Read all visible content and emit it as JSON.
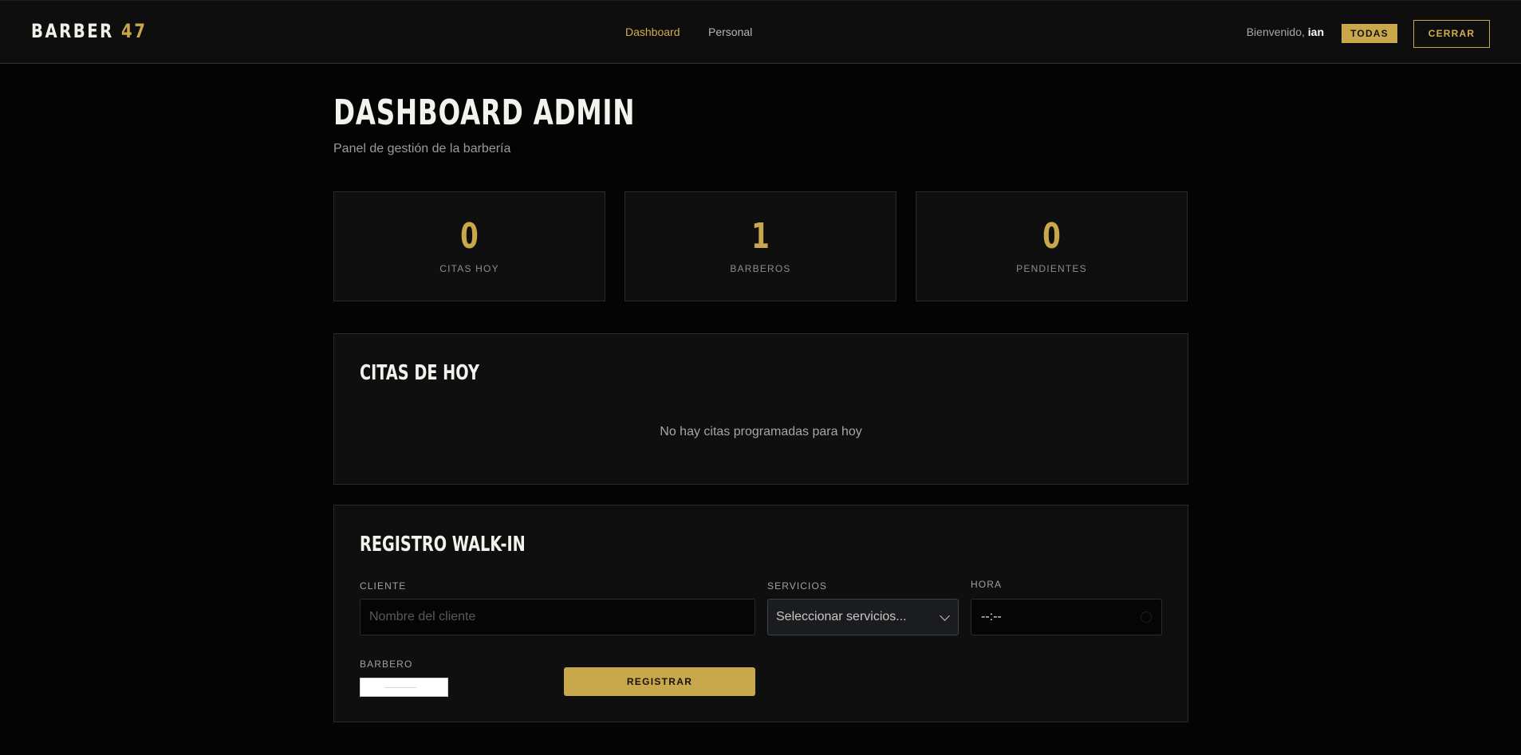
{
  "brand": {
    "name": "BARBER",
    "number": "47",
    "accent_color": "#c9a74b"
  },
  "nav": {
    "links": [
      {
        "label": "Dashboard",
        "active": true
      },
      {
        "label": "Personal",
        "active": false
      }
    ]
  },
  "user": {
    "welcome_prefix": "Bienvenido,",
    "name": "ian",
    "filter_button": "TODAS",
    "logout_button": "CERRAR"
  },
  "page": {
    "title": "DASHBOARD ADMIN",
    "subtitle": "Panel de gestión de la barbería"
  },
  "stats": [
    {
      "value": "0",
      "label": "CITAS HOY"
    },
    {
      "value": "1",
      "label": "BARBEROS"
    },
    {
      "value": "0",
      "label": "PENDIENTES"
    }
  ],
  "today": {
    "title": "CITAS DE HOY",
    "empty_message": "No hay citas programadas para hoy"
  },
  "walkin": {
    "title": "REGISTRO WALK-IN",
    "client_label": "CLIENTE",
    "client_placeholder": "Nombre del cliente",
    "client_value": "",
    "services_label": "SERVICIOS",
    "services_selected": "Seleccionar servicios...",
    "time_label": "HORA",
    "time_value": "--:--",
    "barber_label": "BARBERO",
    "submit_label": "REGISTRAR"
  }
}
